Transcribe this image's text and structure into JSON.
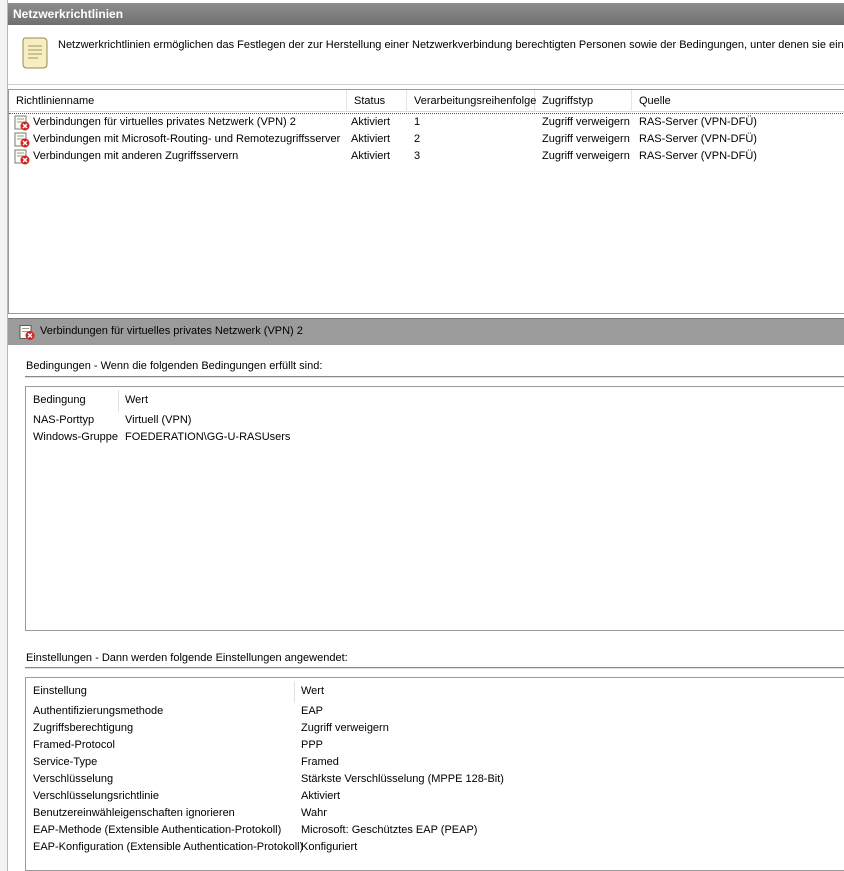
{
  "title": "Netzwerkrichtlinien",
  "description": "Netzwerkrichtlinien ermöglichen das Festlegen der zur Herstellung einer Netzwerkverbindung berechtigten Personen sowie der Bedingungen, unter denen sie eine Verb",
  "policy_table": {
    "columns": [
      "Richtlinienname",
      "Status",
      "Verarbeitungsreihenfolge",
      "Zugriffstyp",
      "Quelle"
    ],
    "rows": [
      {
        "name": "Verbindungen für virtuelles privates Netzwerk (VPN) 2",
        "status": "Aktiviert",
        "order": "1",
        "access": "Zugriff verweigern",
        "source": "RAS-Server (VPN-DFÜ)"
      },
      {
        "name": "Verbindungen mit Microsoft-Routing- und Remotezugriffsserver",
        "status": "Aktiviert",
        "order": "2",
        "access": "Zugriff verweigern",
        "source": "RAS-Server (VPN-DFÜ)"
      },
      {
        "name": "Verbindungen mit anderen Zugriffsservern",
        "status": "Aktiviert",
        "order": "3",
        "access": "Zugriff verweigern",
        "source": "RAS-Server (VPN-DFÜ)"
      }
    ]
  },
  "detail": {
    "title": "Verbindungen für virtuelles privates Netzwerk (VPN) 2",
    "conditions": {
      "section_title": "Bedingungen - Wenn die folgenden Bedingungen erfüllt sind:",
      "col_condition": "Bedingung",
      "col_value": "Wert",
      "rows": [
        {
          "label": "NAS-Porttyp",
          "value": "Virtuell (VPN)"
        },
        {
          "label": "Windows-Gruppe",
          "value": "FOEDERATION\\GG-U-RASUsers"
        }
      ]
    },
    "settings": {
      "section_title": "Einstellungen - Dann werden folgende Einstellungen angewendet:",
      "col_setting": "Einstellung",
      "col_value": "Wert",
      "rows": [
        {
          "label": "Authentifizierungsmethode",
          "value": "EAP"
        },
        {
          "label": "Zugriffsberechtigung",
          "value": "Zugriff verweigern"
        },
        {
          "label": "Framed-Protocol",
          "value": "PPP"
        },
        {
          "label": "Service-Type",
          "value": "Framed"
        },
        {
          "label": "Verschlüsselung",
          "value": "Stärkste Verschlüsselung (MPPE 128-Bit)"
        },
        {
          "label": "Verschlüsselungsrichtlinie",
          "value": "Aktiviert"
        },
        {
          "label": "Benutzereinwähleigenschaften ignorieren",
          "value": "Wahr"
        },
        {
          "label": "EAP-Methode (Extensible Authentication-Protokoll)",
          "value": "Microsoft: Geschütztes EAP (PEAP)"
        },
        {
          "label": "EAP-Konfiguration (Extensible Authentication-Protokoll)",
          "value": "Konfiguriert"
        }
      ]
    }
  },
  "icons": {
    "policy": "policy-deny-icon",
    "description": "document-icon"
  },
  "colors": {
    "titlebar": "#7d7d7d",
    "detail_header": "#9b9b9b",
    "deny_mark": "#d42020"
  }
}
